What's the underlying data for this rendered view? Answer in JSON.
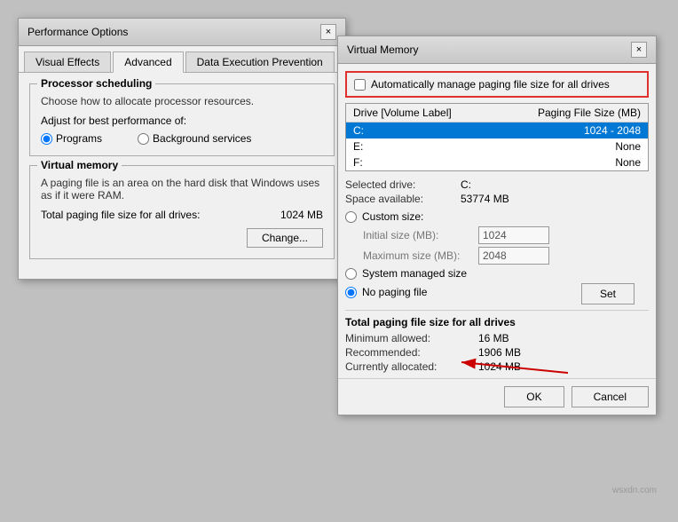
{
  "perf_window": {
    "title": "Performance Options",
    "close_btn": "×",
    "tabs": [
      {
        "id": "visual_effects",
        "label": "Visual Effects"
      },
      {
        "id": "advanced",
        "label": "Advanced",
        "active": true
      },
      {
        "id": "dep",
        "label": "Data Execution Prevention"
      }
    ],
    "processor_section": {
      "label": "Processor scheduling",
      "desc": "Choose how to allocate processor resources.",
      "adjust_label": "Adjust for best performance of:",
      "options": [
        {
          "id": "programs",
          "label": "Programs",
          "selected": true
        },
        {
          "id": "background",
          "label": "Background services"
        }
      ]
    },
    "vm_section": {
      "label": "Virtual memory",
      "desc": "A paging file is an area on the hard disk that Windows uses as if it were RAM.",
      "total_label": "Total paging file size for all drives:",
      "total_value": "1024 MB",
      "change_btn": "Change..."
    }
  },
  "vm_window": {
    "title": "Virtual Memory",
    "close_btn": "×",
    "auto_manage_label": "Automatically manage paging file size for all drives",
    "table": {
      "col1": "Drive  [Volume Label]",
      "col2": "Paging File Size (MB)",
      "rows": [
        {
          "drive": "C:",
          "size": "1024 - 2048",
          "selected": true
        },
        {
          "drive": "E:",
          "size": "None",
          "selected": false
        },
        {
          "drive": "F:",
          "size": "None",
          "selected": false
        }
      ]
    },
    "selected_drive_label": "Selected drive:",
    "selected_drive_value": "C:",
    "space_available_label": "Space available:",
    "space_available_value": "53774 MB",
    "custom_size_label": "Custom size:",
    "initial_size_label": "Initial size (MB):",
    "initial_size_value": "1024",
    "max_size_label": "Maximum size (MB):",
    "max_size_value": "2048",
    "system_managed_label": "System managed size",
    "no_paging_label": "No paging file",
    "set_btn": "Set",
    "total_section": {
      "title": "Total paging file size for all drives",
      "min_label": "Minimum allowed:",
      "min_value": "16 MB",
      "recommended_label": "Recommended:",
      "recommended_value": "1906 MB",
      "allocated_label": "Currently allocated:",
      "allocated_value": "1024 MB"
    },
    "ok_btn": "OK",
    "cancel_btn": "Cancel"
  },
  "watermark": "wsxdn.com"
}
